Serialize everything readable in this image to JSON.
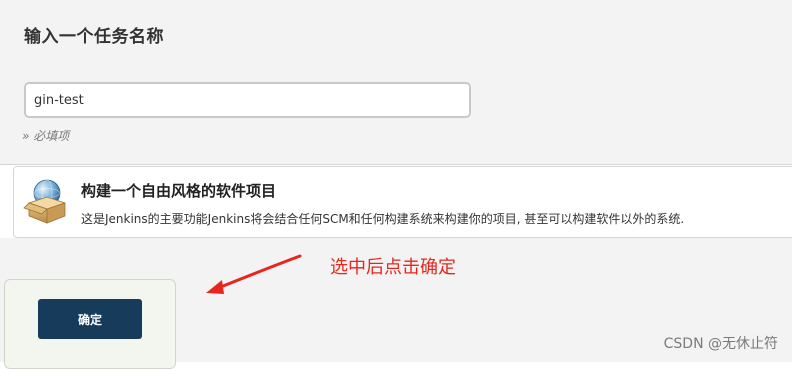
{
  "header": {
    "title": "输入一个任务名称"
  },
  "name_field": {
    "value": "gin-test",
    "required_hint": "» 必填项"
  },
  "project_types": [
    {
      "title": "构建一个自由风格的软件项目",
      "description": "这是Jenkins的主要功能Jenkins将会结合任何SCM和任何构建系统来构建你的项目, 甚至可以构建软件以外的系统.",
      "icon": "freestyle-project-icon"
    }
  ],
  "footer": {
    "ok_label": "确定"
  },
  "annotation": {
    "text": "选中后点击确定",
    "color": "#e8261f"
  },
  "watermark": "CSDN @无休止符",
  "colors": {
    "button_bg": "#173b5a",
    "panel_bg": "#f3f3f3"
  }
}
